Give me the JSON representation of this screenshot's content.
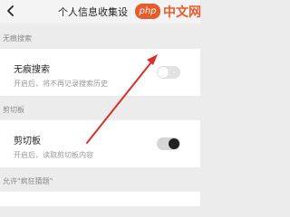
{
  "header": {
    "title": "个人信息收集设",
    "back_icon": "back-arrow-icon"
  },
  "watermark": {
    "badge": "php",
    "text": "中文网"
  },
  "sections": [
    {
      "label": "无痕搜索",
      "items": [
        {
          "title": "无痕搜索",
          "subtitle": "开启后，将不再记录搜索历史",
          "toggle_on": false
        }
      ]
    },
    {
      "label": "剪切板",
      "items": [
        {
          "title": "剪切板",
          "subtitle": "开启后，读取剪切板内容",
          "toggle_on": true
        }
      ]
    },
    {
      "label": "允许\"疯狂猜题\"",
      "items": []
    }
  ],
  "annotation": {
    "type": "red arrow pointing to toggle",
    "color": "#d9302a"
  },
  "colors": {
    "accent_red": "#d9302a",
    "watermark_orange": "#e85b2a",
    "toggle_knob_on": "#222222",
    "toggle_knob_off": "#ffffff"
  }
}
